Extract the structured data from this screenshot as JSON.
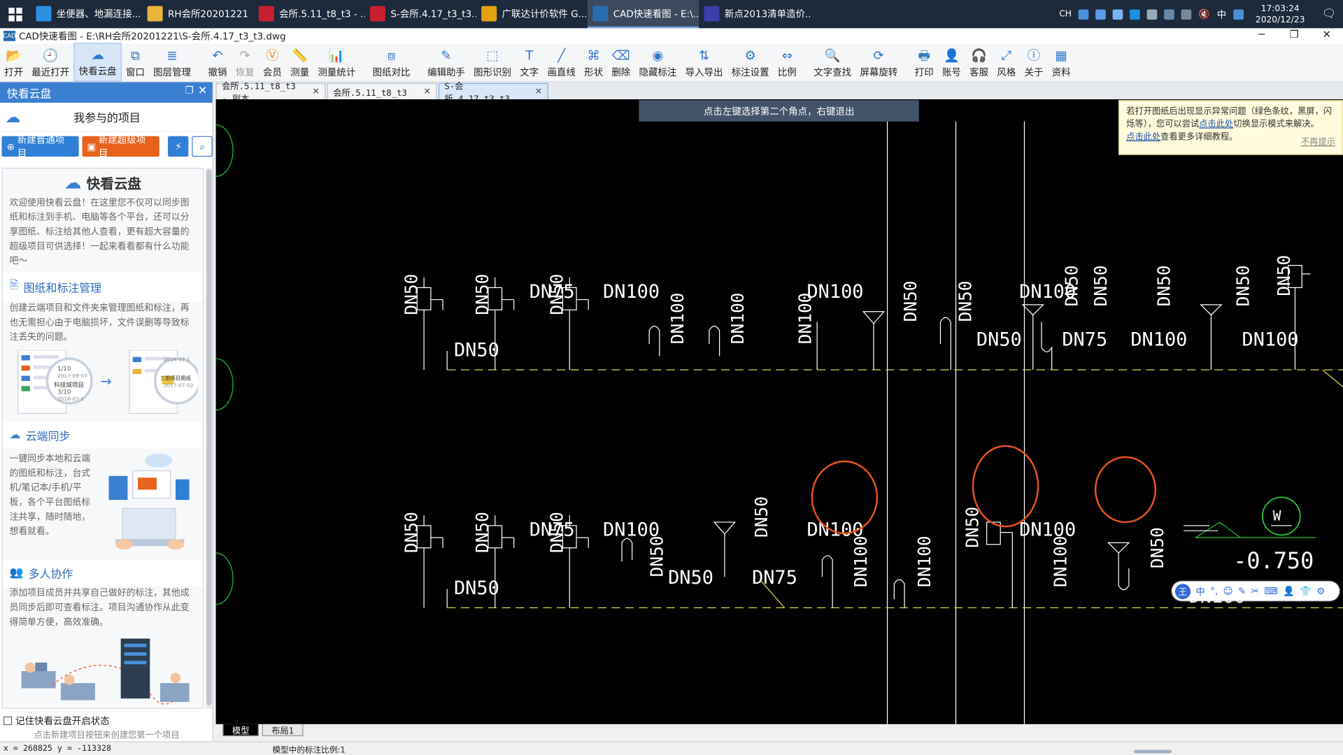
{
  "taskbar": {
    "tasks": [
      {
        "label": "坐便器、地漏连接...",
        "icon": "edge-browser-icon",
        "color": "#2d8fe0"
      },
      {
        "label": "RH会所20201221",
        "icon": "folder-icon",
        "color": "#e8b53a"
      },
      {
        "label": "会所.5.11_t8_t3 - ...",
        "icon": "autocad-icon",
        "color": "#c8202e"
      },
      {
        "label": "S-会所.4.17_t3_t3....",
        "icon": "autocad-icon",
        "color": "#c8202e"
      },
      {
        "label": "广联达计价软件 G...",
        "icon": "glodon-icon",
        "color": "#e3a114"
      },
      {
        "label": "CAD快速看图 - E:\\...",
        "icon": "cad-viewer-icon",
        "color": "#2b6cb0"
      },
      {
        "label": "新点2013清单造价...",
        "icon": "xindian-icon",
        "color": "#3b3fa8"
      }
    ],
    "tray": {
      "ime_mode": "CH",
      "lang": "中",
      "time": "17:03:24",
      "date": "2020/12/23"
    }
  },
  "titlebar": {
    "title": "CAD快速看图 - E:\\RH会所20201221\\S-会所.4.17_t3_t3.dwg"
  },
  "toolbar": {
    "buttons": [
      {
        "id": "open",
        "label": "打开",
        "glyph": "📂",
        "state": ""
      },
      {
        "id": "recent",
        "label": "最近打开",
        "glyph": "🕘",
        "state": ""
      },
      {
        "id": "cloud",
        "label": "快看云盘",
        "glyph": "☁",
        "state": "sel"
      },
      {
        "id": "window",
        "label": "窗口",
        "glyph": "⧉",
        "state": ""
      },
      {
        "id": "layer",
        "label": "图层管理",
        "glyph": "≣",
        "state": ""
      },
      {
        "id": "undo",
        "label": "撤销",
        "glyph": "↶",
        "state": ""
      },
      {
        "id": "redo",
        "label": "恢复",
        "glyph": "↷",
        "state": "dim"
      },
      {
        "id": "vip",
        "label": "会员",
        "glyph": "Ⓥ",
        "state": "orange"
      },
      {
        "id": "measure",
        "label": "测量",
        "glyph": "📏",
        "state": ""
      },
      {
        "id": "measure-stat",
        "label": "测量统计",
        "glyph": "📊",
        "state": ""
      },
      {
        "id": "compare",
        "label": "图纸对比",
        "glyph": "⧈",
        "state": ""
      },
      {
        "id": "edit-helper",
        "label": "编辑助手",
        "glyph": "✎",
        "state": ""
      },
      {
        "id": "shape-recog",
        "label": "图形识别",
        "glyph": "⬚",
        "state": ""
      },
      {
        "id": "text",
        "label": "文字",
        "glyph": "T",
        "state": ""
      },
      {
        "id": "line",
        "label": "画直线",
        "glyph": "╱",
        "state": ""
      },
      {
        "id": "shape",
        "label": "形状",
        "glyph": "⌘",
        "state": ""
      },
      {
        "id": "delete",
        "label": "删除",
        "glyph": "⌫",
        "state": ""
      },
      {
        "id": "hide-anno",
        "label": "隐藏标注",
        "glyph": "◉",
        "state": ""
      },
      {
        "id": "import-export",
        "label": "导入导出",
        "glyph": "⇅",
        "state": ""
      },
      {
        "id": "anno-settings",
        "label": "标注设置",
        "glyph": "⚙",
        "state": ""
      },
      {
        "id": "ratio",
        "label": "比例",
        "glyph": "⇔",
        "state": ""
      },
      {
        "id": "text-find",
        "label": "文字查找",
        "glyph": "🔍",
        "state": ""
      },
      {
        "id": "screen-rotate",
        "label": "屏幕旋转",
        "glyph": "⟳",
        "state": ""
      },
      {
        "id": "print",
        "label": "打印",
        "glyph": "🖶",
        "state": ""
      },
      {
        "id": "account",
        "label": "账号",
        "glyph": "👤",
        "state": ""
      },
      {
        "id": "support",
        "label": "客服",
        "glyph": "🎧",
        "state": ""
      },
      {
        "id": "style",
        "label": "风格",
        "glyph": "⤢",
        "state": ""
      },
      {
        "id": "about",
        "label": "关于",
        "glyph": "ⓘ",
        "state": ""
      },
      {
        "id": "resources",
        "label": "资料",
        "glyph": "▦",
        "state": ""
      }
    ]
  },
  "side": {
    "title": "快看云盘",
    "project_label": "我参与的项目",
    "btn_new_normal": "新建普通项目",
    "btn_new_super": "新建超级项目",
    "info_title": "快看云盘",
    "intro": "欢迎使用快看云盘！在这里您不仅可以同步图纸和标注到手机、电脑等各个平台，还可以分享图纸、标注给其他人查看，更有超大容量的超级项目可供选择！一起来看看都有什么功能吧～",
    "sections": [
      {
        "title": "图纸和标注管理",
        "text": "创建云端项目和文件夹来管理图纸和标注，再也无需担心由于电脑损坏，文件误删等导致标注丢失的问题。",
        "illu": [
          "科技城项目",
          "1/10",
          "3/10",
          "三期项目图纸",
          "2017-09-07",
          "2016-07-1",
          "2017-07-02"
        ]
      },
      {
        "title": "云端同步",
        "text": "一键同步本地和云端的图纸和标注，台式机/笔记本/手机/平板，各个平台图纸标注共享，随时随地，想看就看。"
      },
      {
        "title": "多人协作",
        "text": "添加项目成员并共享自己做好的标注，其他成员同步后即可查看标注。项目沟通协作从此变得简单方便，高效准确。"
      }
    ],
    "remember": "记住快看云盘开启状态",
    "hint": "点击新建项目按钮来创建您第一个项目"
  },
  "tabs": [
    {
      "label": "会所.5.11_t8_t3 - 副本",
      "close": "✕",
      "active": false
    },
    {
      "label": "会所.5.11_t8_t3",
      "close": "✕",
      "active": false
    },
    {
      "label": "S-会所.4.17_t3_t3",
      "close": "✕",
      "active": true
    }
  ],
  "canvas": {
    "prompt": "点击左键选择第二个角点，右键退出",
    "notice": {
      "text1": "若打开图纸后出现显示异常问题（绿色条纹，黑屏，闪烁等），您可以尝试",
      "link1": "点击此处",
      "text2": "切换显示模式来解决。",
      "link2": "点击此处",
      "text3": "查看更多详细教程。",
      "dismiss": "不再提示"
    },
    "labels": {
      "dn50": "DN50",
      "dn75": "DN75",
      "dn100": "DN100",
      "elev": "-0.750",
      "w": "W"
    },
    "ime": {
      "logo": "王",
      "mode": "中"
    }
  },
  "layout_tabs": [
    {
      "label": "模型",
      "active": true
    },
    {
      "label": "布局1",
      "active": false
    }
  ],
  "status": {
    "coords": "x = 268825  y = -113328",
    "scale": "模型中的标注比例:1"
  },
  "colors": {
    "accent": "#3b7fd1",
    "pipe": "#d6d84a",
    "cad_line": "#ffffff",
    "circle": "#e8541c",
    "green": "#22c23a"
  }
}
